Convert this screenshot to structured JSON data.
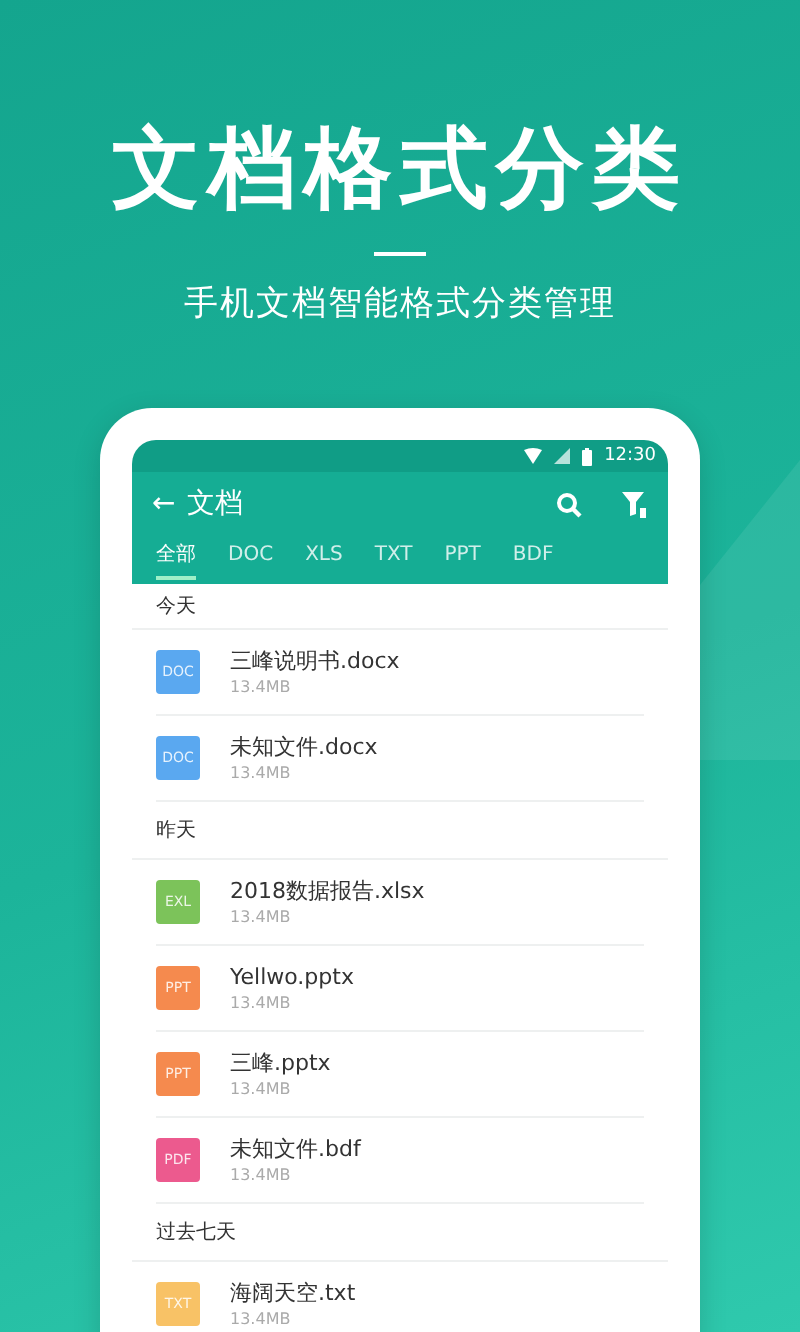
{
  "headline": "文档格式分类",
  "subtitle": "手机文档智能格式分类管理",
  "status_bar": {
    "time": "12:30"
  },
  "toolbar": {
    "back": "←",
    "title": "文档"
  },
  "tabs": [
    {
      "label": "全部",
      "selected": true
    },
    {
      "label": "DOC",
      "selected": false
    },
    {
      "label": "XLS",
      "selected": false
    },
    {
      "label": "TXT",
      "selected": false
    },
    {
      "label": "PPT",
      "selected": false
    },
    {
      "label": "BDF",
      "selected": false
    }
  ],
  "sections": [
    {
      "title": "今天",
      "files": [
        {
          "badge": "DOC",
          "color": "#5aa8f0",
          "name": "三峰说明书.docx",
          "size": "13.4MB"
        },
        {
          "badge": "DOC",
          "color": "#5aa8f0",
          "name": "未知文件.docx",
          "size": "13.4MB"
        }
      ]
    },
    {
      "title": "昨天",
      "files": [
        {
          "badge": "EXL",
          "color": "#7cc35a",
          "name": "2018数据报告.xlsx",
          "size": "13.4MB"
        },
        {
          "badge": "PPT",
          "color": "#f58a4e",
          "name": "Yellwo.pptx",
          "size": "13.4MB"
        },
        {
          "badge": "PPT",
          "color": "#f58a4e",
          "name": "三峰.pptx",
          "size": "13.4MB"
        },
        {
          "badge": "PDF",
          "color": "#ec5a8e",
          "name": "未知文件.bdf",
          "size": "13.4MB"
        }
      ]
    },
    {
      "title": "过去七天",
      "files": [
        {
          "badge": "TXT",
          "color": "#f8c266",
          "name": "海阔天空.txt",
          "size": "13.4MB"
        }
      ]
    }
  ]
}
